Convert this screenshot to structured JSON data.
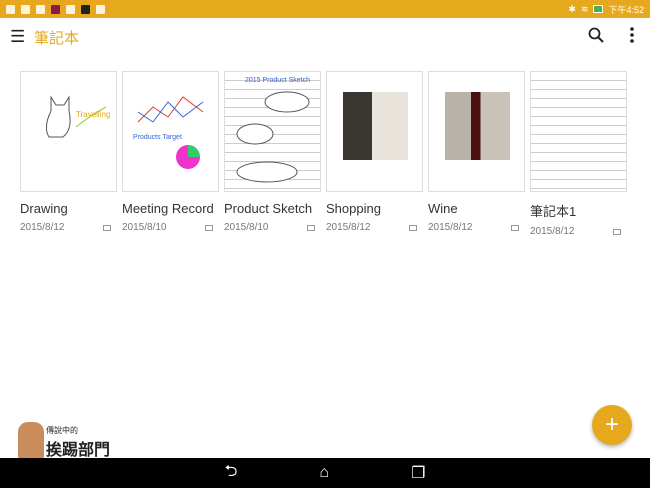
{
  "status": {
    "time": "下午4:52"
  },
  "appbar": {
    "title": "筆記本"
  },
  "notebooks": [
    {
      "name": "Drawing",
      "date": "2015/8/12"
    },
    {
      "name": "Meeting Record",
      "date": "2015/8/10"
    },
    {
      "name": "Product Sketch",
      "date": "2015/8/10"
    },
    {
      "name": "Shopping",
      "date": "2015/8/12"
    },
    {
      "name": "Wine",
      "date": "2015/8/12"
    },
    {
      "name": "筆記本1",
      "date": "2015/8/12"
    }
  ],
  "fab": {
    "label": "+"
  },
  "watermark": {
    "line1": "傳說中的",
    "line2": "挨踢部門"
  },
  "colors": {
    "accent": "#e6a91e"
  }
}
